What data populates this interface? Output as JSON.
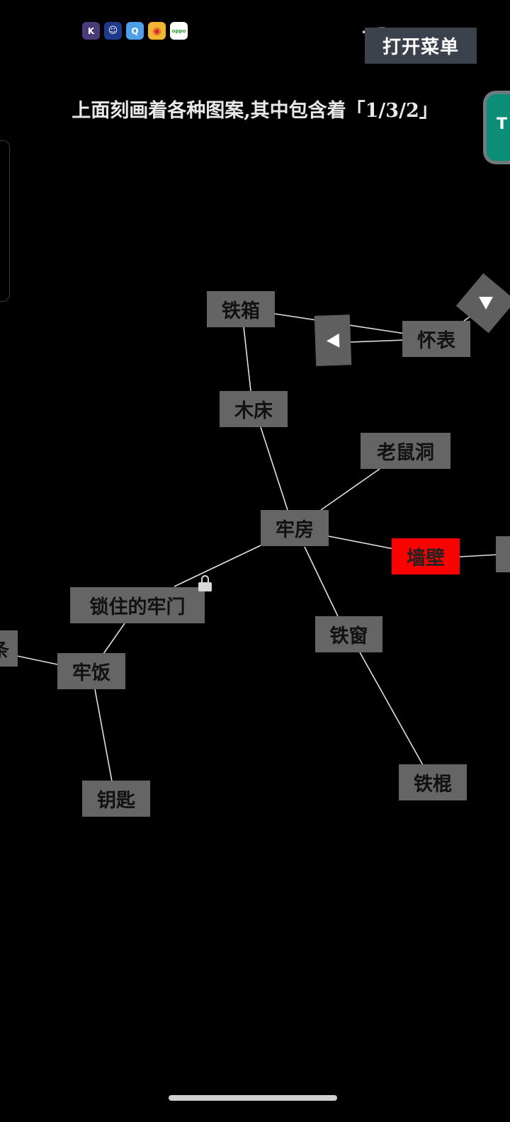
{
  "status_bar": {
    "notification_icons": [
      {
        "name": "k-app-icon",
        "glyph": "K"
      },
      {
        "name": "robot-face-app-icon",
        "glyph": "☺"
      },
      {
        "name": "qq-browser-app-icon",
        "glyph": "Q"
      },
      {
        "name": "weibo-app-icon",
        "glyph": "◉"
      },
      {
        "name": "oppo-store-app-icon",
        "glyph": "oppo"
      }
    ]
  },
  "menu": {
    "open_label": "打开菜单"
  },
  "message": "上面刻画着各种图案,其中包含着「1/3/2」",
  "edge_widget_glyph": "T",
  "nodes": {
    "tie_xiang": "铁箱",
    "huai_biao": "怀表",
    "mu_chuang": "木床",
    "lao_shu_dong": "老鼠洞",
    "lao_fang": "牢房",
    "qiang_bi": "墙壁",
    "suo_zhu_lao_men": "锁住的牢门",
    "tie_chuang": "铁窗",
    "lao_fan": "牢饭",
    "yao_shi": "钥匙",
    "tie_gun": "铁棍",
    "left_partial": "条"
  },
  "locked_node": "锁住的牢门",
  "selected_node": "墙壁",
  "colors": {
    "background": "#000000",
    "node": "#656565",
    "node_selected": "#ff0000",
    "edge": "#e0e0e0",
    "menu_button": "#3c424b"
  }
}
